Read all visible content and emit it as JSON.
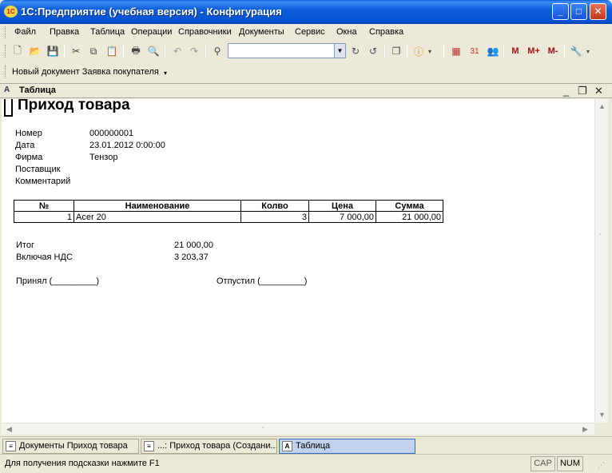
{
  "window": {
    "title": "1С:Предприятие (учебная версия) - Конфигурация",
    "app_icon": "1C",
    "minimize": "_",
    "maximize": "□",
    "close": "✕"
  },
  "menu": [
    {
      "label": "Файл"
    },
    {
      "label": "Правка"
    },
    {
      "label": "Таблица"
    },
    {
      "label": "Операции"
    },
    {
      "label": "Справочники"
    },
    {
      "label": "Документы"
    },
    {
      "label": "Сервис"
    },
    {
      "label": "Окна"
    },
    {
      "label": "Справка"
    }
  ],
  "toolbar": {
    "search_value": "",
    "m_label": "M",
    "mplus_label": "M+",
    "mminus_label": "M-"
  },
  "toolbar2": {
    "new_document_label": "Новый документ Заявка покупателя"
  },
  "inner_window": {
    "title": "Таблица",
    "icon": "A"
  },
  "document": {
    "title": "Приход товара",
    "fields": [
      {
        "label": "Номер",
        "value": "000000001"
      },
      {
        "label": "Дата",
        "value": "23.01.2012 0:00:00"
      },
      {
        "label": "Фирма",
        "value": "Тензор"
      },
      {
        "label": "Поставщик",
        "value": ""
      },
      {
        "label": "Комментарий",
        "value": ""
      }
    ],
    "table": {
      "headers": [
        "№",
        "Наименование",
        "Колво",
        "Цена",
        "Сумма"
      ],
      "rows": [
        [
          "1",
          "Acer 20",
          "3",
          "7 000,00",
          "21 000,00"
        ]
      ]
    },
    "total_label": "Итог",
    "total_value": "21 000,00",
    "vat_label": "Включая НДС",
    "vat_value": "3 203,37",
    "accepted_label": "Принял (_________)",
    "released_label": "Отпустил (_________)"
  },
  "window_tabs": [
    {
      "label": "Документы Приход товара",
      "active": false
    },
    {
      "label": "...: Приход товара (Создани...",
      "active": false
    },
    {
      "label": "Таблица",
      "active": true
    }
  ],
  "status": {
    "hint": "Для получения подсказки нажмите F1",
    "cap": "CAP",
    "num": "NUM"
  },
  "colors": {
    "titlebar": "#0553d1",
    "active_tab": "#c1d2ee"
  }
}
